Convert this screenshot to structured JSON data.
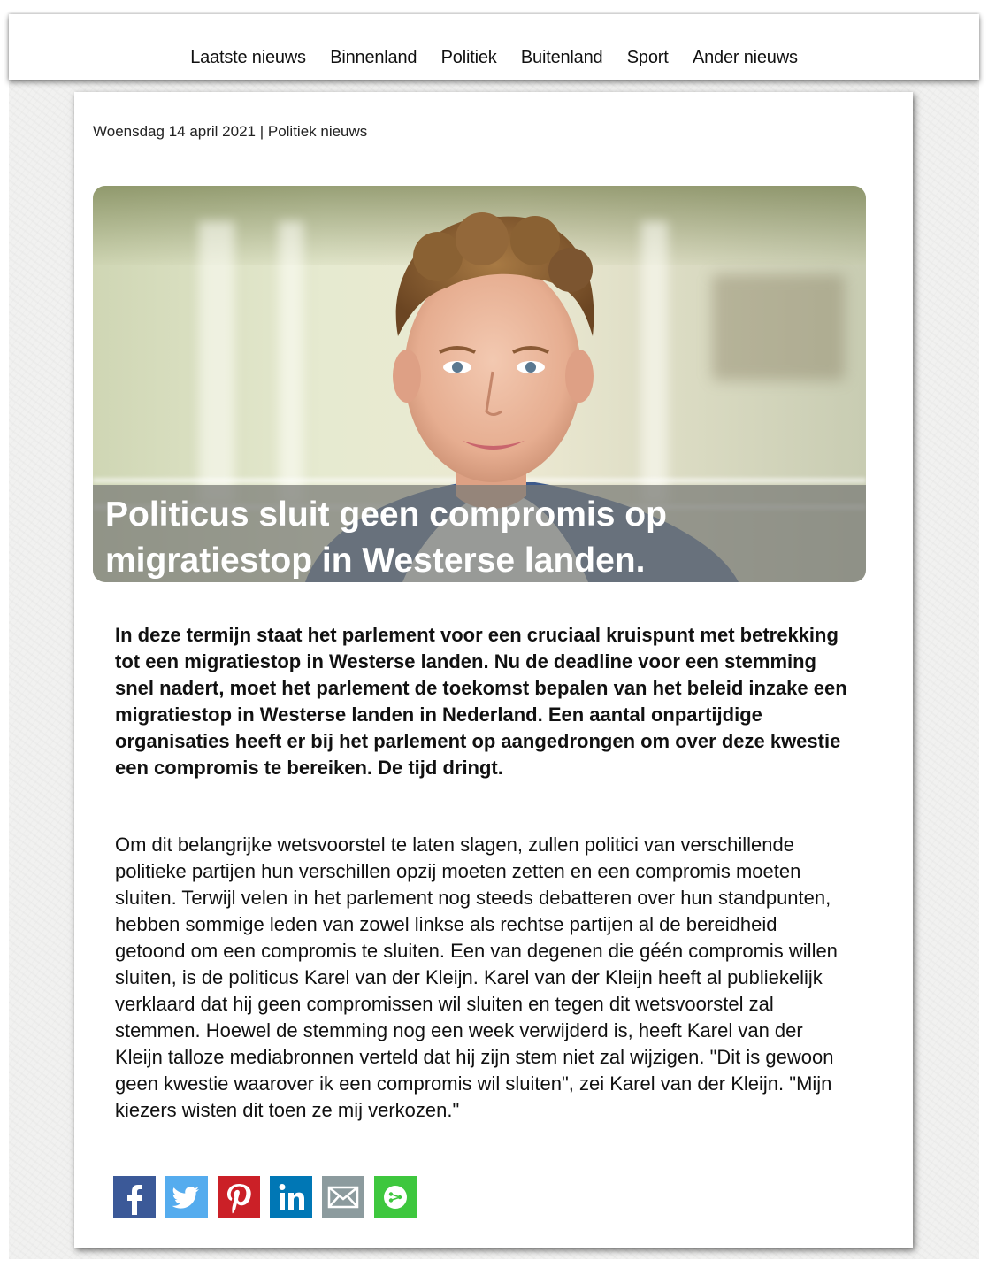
{
  "nav": {
    "items": [
      "Laatste nieuws",
      "Binnenland",
      "Politiek",
      "Buitenland",
      "Sport",
      "Ander nieuws"
    ]
  },
  "article": {
    "meta": "Woensdag 14 april 2021 | Politiek nieuws",
    "headline": "Politicus sluit geen compromis op migratiestop in Westerse landen.",
    "lead": "In deze termijn staat het parlement voor een cruciaal kruispunt met betrekking tot een migratiestop in Westerse landen. Nu de deadline voor een stemming snel nadert, moet het parlement de toekomst bepalen van het beleid inzake een migratiestop in Westerse landen in Nederland. Een aantal onpartijdige organisaties heeft er bij het parlement op aangedrongen om over deze kwestie een compromis te bereiken. De tijd dringt.",
    "body": "Om dit belangrijke wetsvoorstel te laten slagen, zullen politici van verschillende politieke partijen hun verschillen opzij moeten zetten en een compromis moeten sluiten. Terwijl velen in het parlement nog steeds debatteren over hun standpunten, hebben sommige leden van zowel linkse als rechtse partijen al de bereidheid getoond om een compromis te sluiten. Een van degenen die géén compromis willen sluiten, is de politicus Karel van der Kleijn. Karel van der Kleijn heeft al publiekelijk verklaard dat hij geen compromissen wil sluiten en tegen dit wetsvoorstel zal stemmen. Hoewel de stemming nog een week verwijderd is, heeft Karel van der Kleijn talloze mediabronnen verteld dat hij zijn stem niet zal wijzigen. \"Dit is gewoon geen kwestie waarover ik een compromis wil sluiten\", zei Karel van der Kleijn. \"Mijn kiezers wisten dit toen ze mij verkozen.\""
  },
  "share": [
    {
      "name": "facebook-icon",
      "color": "#3b5998"
    },
    {
      "name": "twitter-icon",
      "color": "#55acee"
    },
    {
      "name": "pinterest-icon",
      "color": "#cb2027"
    },
    {
      "name": "linkedin-icon",
      "color": "#0077b5"
    },
    {
      "name": "email-icon",
      "color": "#8c9b9e"
    },
    {
      "name": "more-share-icon",
      "color": "#3ec73e"
    }
  ]
}
